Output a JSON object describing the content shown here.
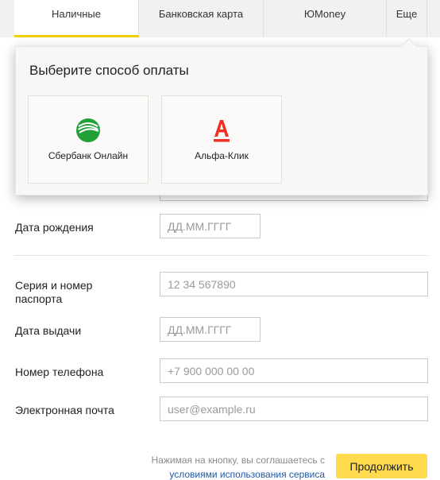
{
  "tabs": [
    {
      "label": "Наличные",
      "active": true
    },
    {
      "label": "Банковская карта",
      "active": false
    },
    {
      "label": "ЮMoney",
      "active": false
    },
    {
      "label": "Еще",
      "active": false
    }
  ],
  "form": {
    "birth_date": {
      "label": "Дата рождения",
      "placeholder": "ДД.ММ.ГГГГ"
    },
    "passport": {
      "label": "Серия и номер паспорта",
      "placeholder": "12 34 567890"
    },
    "issue_date": {
      "label": "Дата выдачи",
      "placeholder": "ДД.ММ.ГГГГ"
    },
    "phone": {
      "label": "Номер телефона",
      "placeholder": "+7 900 000 00 00"
    },
    "email": {
      "label": "Электронная почта",
      "placeholder": "user@example.ru"
    }
  },
  "footer": {
    "agreement_text": "Нажимая на кнопку, вы соглашаетесь с",
    "agreement_link": "условиями использования сервиса",
    "submit_label": "Продолжить"
  },
  "payment_panel": {
    "title": "Выберите способ оплаты",
    "methods": [
      {
        "name": "Сбербанк Онлайн",
        "icon": "sberbank-logo-icon"
      },
      {
        "name": "Альфа-Клик",
        "icon": "alfa-bank-logo-icon"
      }
    ]
  },
  "colors": {
    "accent": "#f5d000",
    "button": "#ffdb4d",
    "link": "#1f58a6",
    "sber_green": "#21a038",
    "alfa_red": "#ef3124"
  }
}
